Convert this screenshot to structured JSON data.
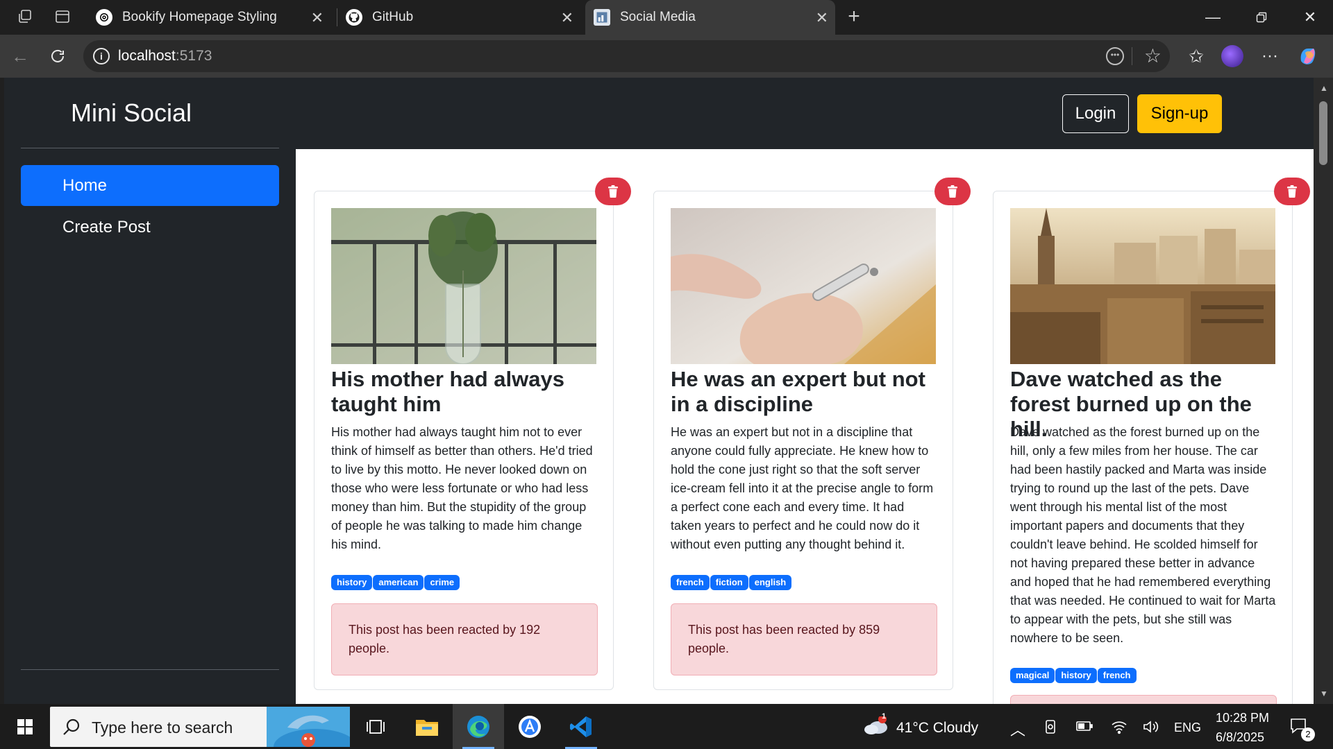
{
  "browser": {
    "tabs": [
      {
        "title": "Bookify Homepage Styling",
        "icon": "openai-icon"
      },
      {
        "title": "GitHub",
        "icon": "github-icon"
      },
      {
        "title": "Social Media",
        "icon": "page-icon"
      }
    ],
    "url_host": "localhost",
    "url_port": ":5173"
  },
  "app": {
    "brand": "Mini Social",
    "login_label": "Login",
    "signup_label": "Sign-up",
    "nav": [
      {
        "label": "Home",
        "active": true
      },
      {
        "label": "Create Post",
        "active": false
      }
    ]
  },
  "posts": [
    {
      "title": "His mother had always taught him",
      "body": "His mother had always taught him not to ever think of himself as better than others. He'd tried to live by this motto. He never looked down on those who were less fortunate or who had less money than him. But the stupidity of the group of people he was talking to made him change his mind.",
      "tags": [
        "history",
        "american",
        "crime"
      ],
      "reaction": "This post has been reacted by 192 people."
    },
    {
      "title": "He was an expert but not in a discipline",
      "body": "He was an expert but not in a discipline that anyone could fully appreciate. He knew how to hold the cone just right so that the soft server ice-cream fell into it at the precise angle to form a perfect cone each and every time. It had taken years to perfect and he could now do it without even putting any thought behind it.",
      "tags": [
        "french",
        "fiction",
        "english"
      ],
      "reaction": "This post has been reacted by 859 people."
    },
    {
      "title": "Dave watched as the forest burned up on the hill.",
      "body": "Dave watched as the forest burned up on the hill, only a few miles from her house. The car had been hastily packed and Marta was inside trying to round up the last of the pets. Dave went through his mental list of the most important papers and documents that they couldn't leave behind. He scolded himself for not having prepared these better in advance and hoped that he had remembered everything that was needed. He continued to wait for Marta to appear with the pets, but she still was nowhere to be seen.",
      "tags": [
        "magical",
        "history",
        "french"
      ],
      "reaction": ""
    }
  ],
  "taskbar": {
    "search_placeholder": "Type here to search",
    "weather": "41°C  Cloudy",
    "weather_badge": "1",
    "lang": "ENG",
    "time": "10:28 PM",
    "date": "6/8/2025",
    "notifications": "2"
  }
}
